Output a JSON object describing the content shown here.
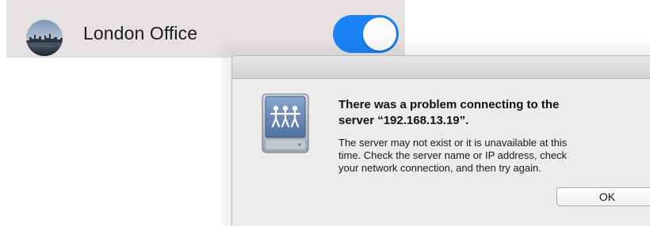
{
  "vpn": {
    "name": "London Office",
    "enabled": true,
    "toggle_color": "#1b83f5",
    "avatar_icon": "london-skyline-avatar"
  },
  "alert": {
    "icon": "server-share-icon",
    "title": "There was a problem connecting to the\nserver “192.168.13.19”.",
    "message": "The server may not exist or it is unavailable at this\ntime. Check the server name or IP address, check\nyour network connection, and then try again.",
    "ok_label": "OK"
  }
}
